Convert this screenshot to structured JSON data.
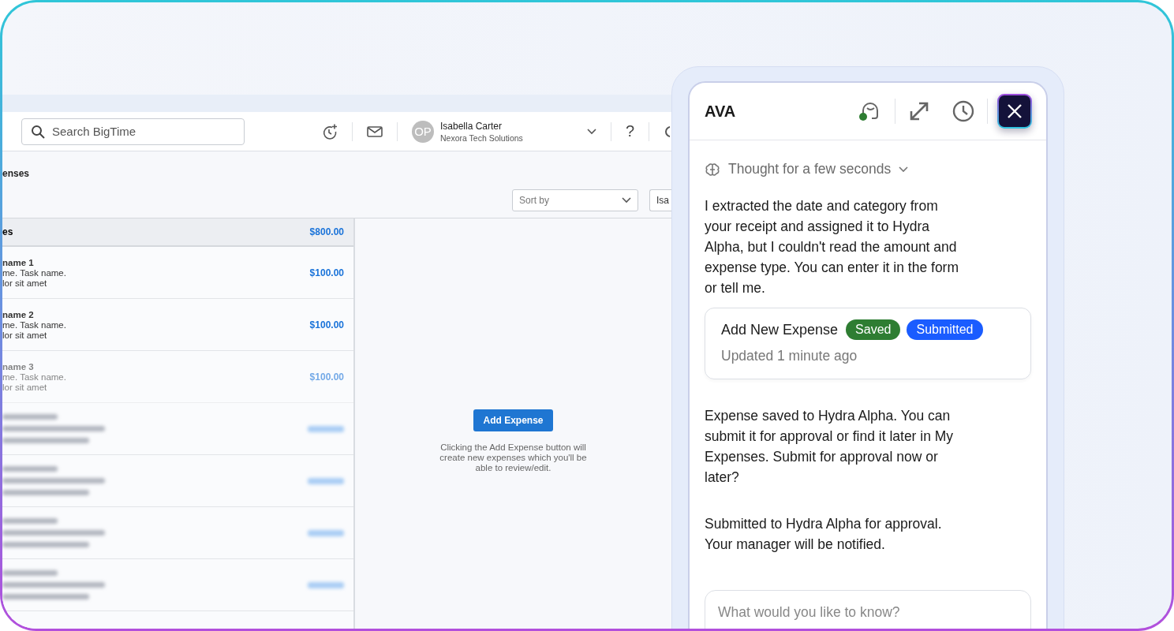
{
  "app": {
    "search": {
      "placeholder": "Search BigTime"
    },
    "user": {
      "initials": "OP",
      "name": "Isabella Carter",
      "company": "Nexora Tech Solutions"
    },
    "help": "?",
    "page_title": "enses",
    "sort": {
      "placeholder": "Sort by"
    },
    "filter_button": "Isa",
    "list": {
      "header": {
        "label": "es",
        "amount": "$800.00"
      },
      "rows": [
        {
          "kind": "text",
          "title": "name 1",
          "line_2": "me. Task name.",
          "line_3": "lor sit amet",
          "amount": "$100.00"
        },
        {
          "kind": "text",
          "title": "name 2",
          "line_2": "me. Task name.",
          "line_3": "lor sit amet",
          "amount": "$100.00"
        },
        {
          "kind": "text",
          "title": "name 3",
          "line_2": "me. Task name.",
          "line_3": "lor sit amet",
          "amount": "$100.00"
        },
        {
          "kind": "blurred"
        },
        {
          "kind": "blurred"
        },
        {
          "kind": "blurred"
        },
        {
          "kind": "blurred"
        }
      ]
    },
    "empty_state": {
      "button": "Add Expense",
      "caption": "Clicking the Add Expense button will create new expenses which you'll be able to review/edit."
    }
  },
  "assistant": {
    "title": "AVA",
    "agent_online": true,
    "thinking": {
      "label": "Thought for a few seconds",
      "expanded": false
    },
    "messages": [
      {
        "kind": "text",
        "text": "I extracted the date and category from your receipt and assigned it to Hydra Alpha, but I couldn't read the amount and expense type. You can enter it in the form or tell me."
      },
      {
        "kind": "card",
        "title": "Add New Expense",
        "badges": [
          {
            "label": "Saved",
            "color": "#2e7d32"
          },
          {
            "label": "Submitted",
            "color": "#1a5cff"
          }
        ],
        "subtitle": "Updated 1 minute ago"
      },
      {
        "kind": "text",
        "text": "Expense saved to Hydra Alpha. You can submit it for approval or find it later in My Expenses. Submit for approval now or later?"
      },
      {
        "kind": "text",
        "text": "Submitted to Hydra Alpha for approval. Your manager will be notified."
      }
    ],
    "input": {
      "placeholder": "What would you like to know?"
    }
  }
}
